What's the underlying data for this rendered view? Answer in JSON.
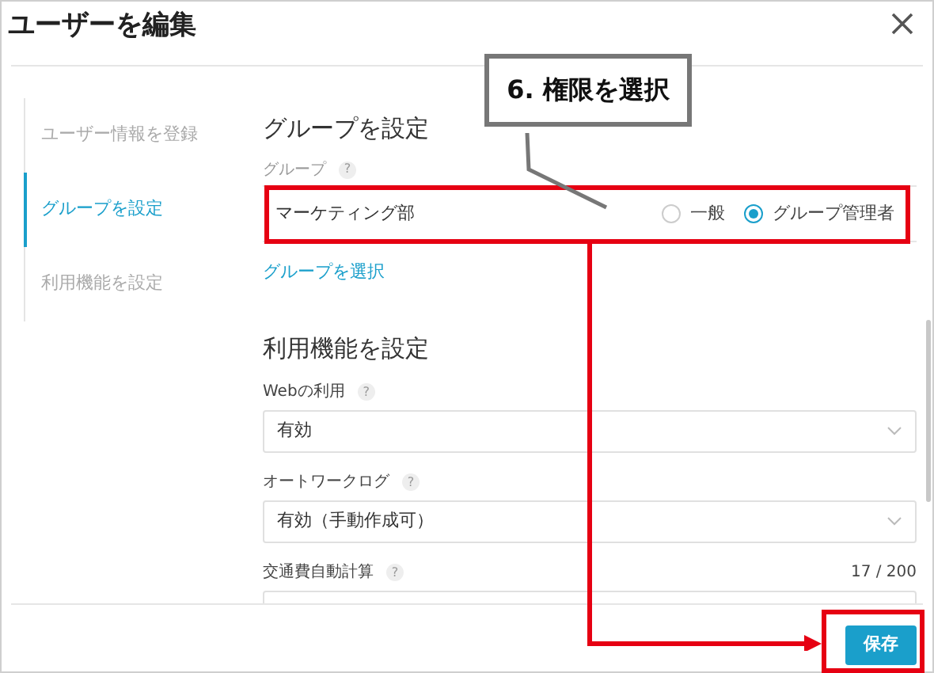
{
  "dialog": {
    "title": "ユーザーを編集"
  },
  "steps": [
    {
      "label": "ユーザー情報を登録",
      "selected": false
    },
    {
      "label": "グループを設定",
      "selected": true
    },
    {
      "label": "利用機能を設定",
      "selected": false
    }
  ],
  "group_section": {
    "title": "グループを設定",
    "label": "グループ",
    "help": "?",
    "group_name": "マーケティング部",
    "roles": [
      {
        "label": "一般",
        "selected": false
      },
      {
        "label": "グループ管理者",
        "selected": true
      }
    ],
    "link": "グループを選択"
  },
  "feature_section": {
    "title": "利用機能を設定",
    "fields": [
      {
        "label": "Webの利用",
        "help": "?",
        "value": "有効"
      },
      {
        "label": "オートワークログ",
        "help": "?",
        "value": "有効（手動作成可）"
      },
      {
        "label": "交通費自動計算",
        "help": "?",
        "counter": "17 / 200"
      }
    ]
  },
  "save_button": "保存",
  "annotation": {
    "callout": "6. 権限を選択"
  }
}
